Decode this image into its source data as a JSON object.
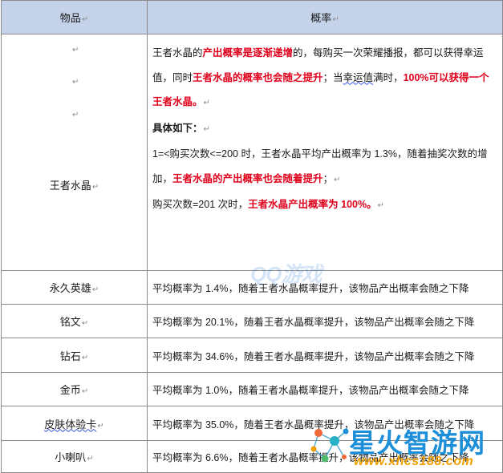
{
  "table": {
    "headers": [
      "物品",
      "概率"
    ],
    "para_mark": "↵",
    "lead_marks": [
      "↵",
      "↵",
      "↵"
    ],
    "big_row": {
      "item": "王者水晶",
      "lines": [
        [
          {
            "text": "王者水晶的",
            "style": "plain"
          },
          {
            "text": "产出概率是逐渐递增",
            "style": "red"
          },
          {
            "text": "的，每购买一次荣耀播报，都可以获得幸运值，同时",
            "style": "plain"
          },
          {
            "text": "王者水晶的概率也会随之提升",
            "style": "red"
          },
          {
            "text": "；当",
            "style": "plain"
          },
          {
            "text": "幸运值",
            "style": "squiggle"
          },
          {
            "text": "满时，",
            "style": "plain"
          },
          {
            "text": "100%可以获得一个王者水晶。",
            "style": "red"
          },
          {
            "text": "↵",
            "style": "mark"
          }
        ],
        [
          {
            "text": "具体如下：",
            "style": "bold"
          },
          {
            "text": "↵",
            "style": "mark"
          }
        ],
        [
          {
            "text": "1=<购买次数<=200 时，王者水晶平均产出概率为 1.3%，随着抽奖次数的增加，",
            "style": "plain"
          },
          {
            "text": "王者水晶的产出概率也会随着提升",
            "style": "red"
          },
          {
            "text": "；",
            "style": "plain"
          },
          {
            "text": "↵",
            "style": "mark"
          }
        ],
        [
          {
            "text": "购买次数=201 次时，",
            "style": "plain"
          },
          {
            "text": "王者水晶产出概率为 100%。",
            "style": "red"
          },
          {
            "text": "↵",
            "style": "mark"
          }
        ]
      ]
    },
    "rows": [
      {
        "item": "永久英雄",
        "desc": "平均概率为 1.4%，随着王者水晶概率提升，该物品产出概率会随之下降",
        "squiggle": false
      },
      {
        "item": "铭文",
        "desc": "平均概率为 20.1%，随着王者水晶概率提升，该物品产出概率会随之下降",
        "squiggle": false
      },
      {
        "item": "钻石",
        "desc": "平均概率为 34.6%，随着王者水晶概率提升，该物品产出概率会随之下降",
        "squiggle": false
      },
      {
        "item": "金币",
        "desc": "平均概率为 1.0%，随着王者水晶概率提升，该物品产出概率会随之下降",
        "squiggle": false
      },
      {
        "item": "皮肤体验卡",
        "desc": "平均概率为 35.0%，随着王者水晶概率提升，该物品产出概率会随之下降",
        "squiggle": true
      },
      {
        "item": "小喇叭",
        "desc": "平均概率为 6.6%，随着王者水晶概率提升，该物品产出概率会随之下降",
        "squiggle": false
      }
    ]
  },
  "watermarks": {
    "top": "QQ游戏",
    "brand": "星火智游网",
    "url": "www.xhcs188.com"
  },
  "colors": {
    "header_bg": "#c5d3ea",
    "emphasis_red": "#e0001b",
    "border": "#8a8a8a",
    "brand_blue": "#1c8fd8",
    "brand_orange": "#f2a000"
  }
}
